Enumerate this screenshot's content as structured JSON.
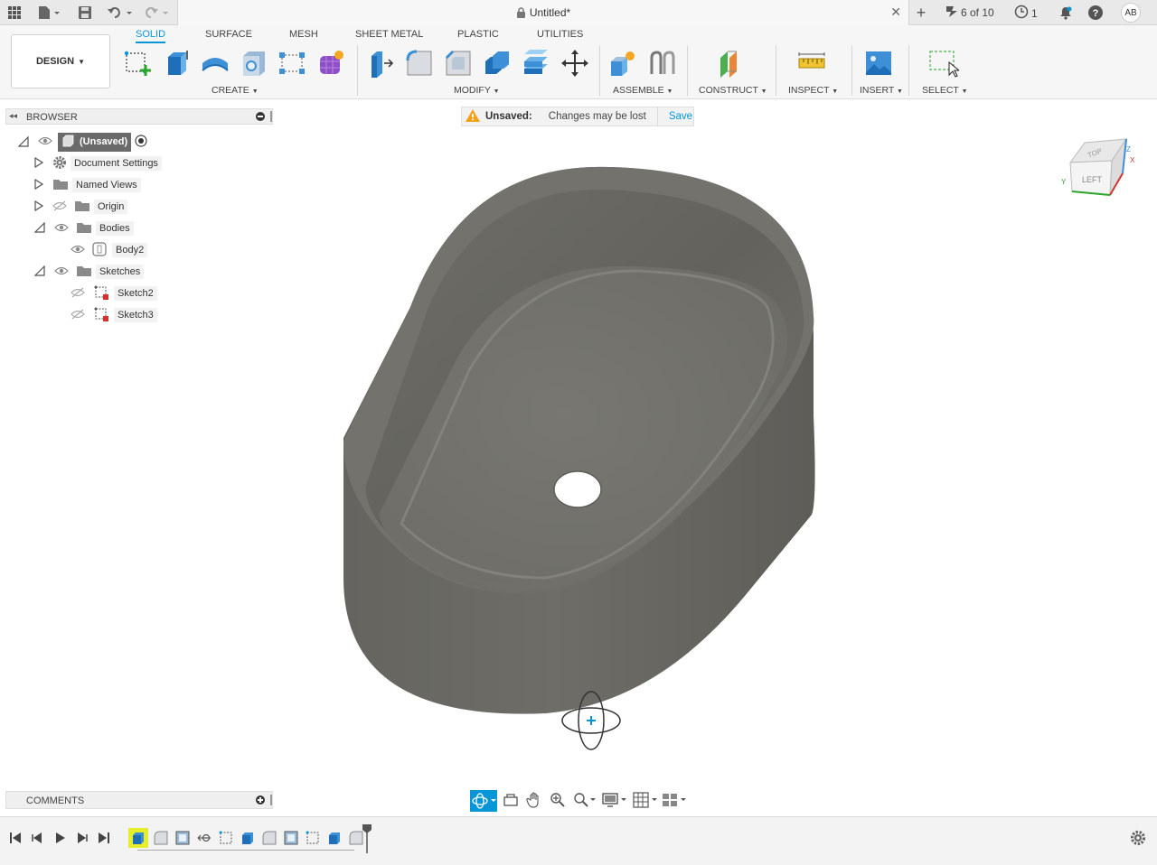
{
  "titlebar": {
    "doc_title": "Untitled*",
    "jobs": "6 of 10",
    "clock_count": "1",
    "avatar": "AB"
  },
  "toolbar": {
    "workspace": "DESIGN",
    "tabs": [
      "SOLID",
      "SURFACE",
      "MESH",
      "SHEET METAL",
      "PLASTIC",
      "UTILITIES"
    ],
    "active_tab": "SOLID",
    "groups": {
      "create": "CREATE",
      "modify": "MODIFY",
      "assemble": "ASSEMBLE",
      "construct": "CONSTRUCT",
      "inspect": "INSPECT",
      "insert": "INSERT",
      "select": "SELECT"
    }
  },
  "browser": {
    "title": "BROWSER",
    "root": "(Unsaved)",
    "items": {
      "doc_settings": "Document Settings",
      "named_views": "Named Views",
      "origin": "Origin",
      "bodies": "Bodies",
      "body2": "Body2",
      "sketches": "Sketches",
      "sketch2": "Sketch2",
      "sketch3": "Sketch3"
    }
  },
  "notice": {
    "label": "Unsaved:",
    "message": "Changes may be lost",
    "action": "Save"
  },
  "viewcube": {
    "top": "TOP",
    "left": "LEFT",
    "axis_z": "Z",
    "axis_x": "X",
    "axis_y": "Y"
  },
  "comments": {
    "title": "COMMENTS"
  },
  "colors": {
    "accent": "#0696d7",
    "model": "#6f6e68",
    "timeline_highlight": "#e6ee2a"
  }
}
